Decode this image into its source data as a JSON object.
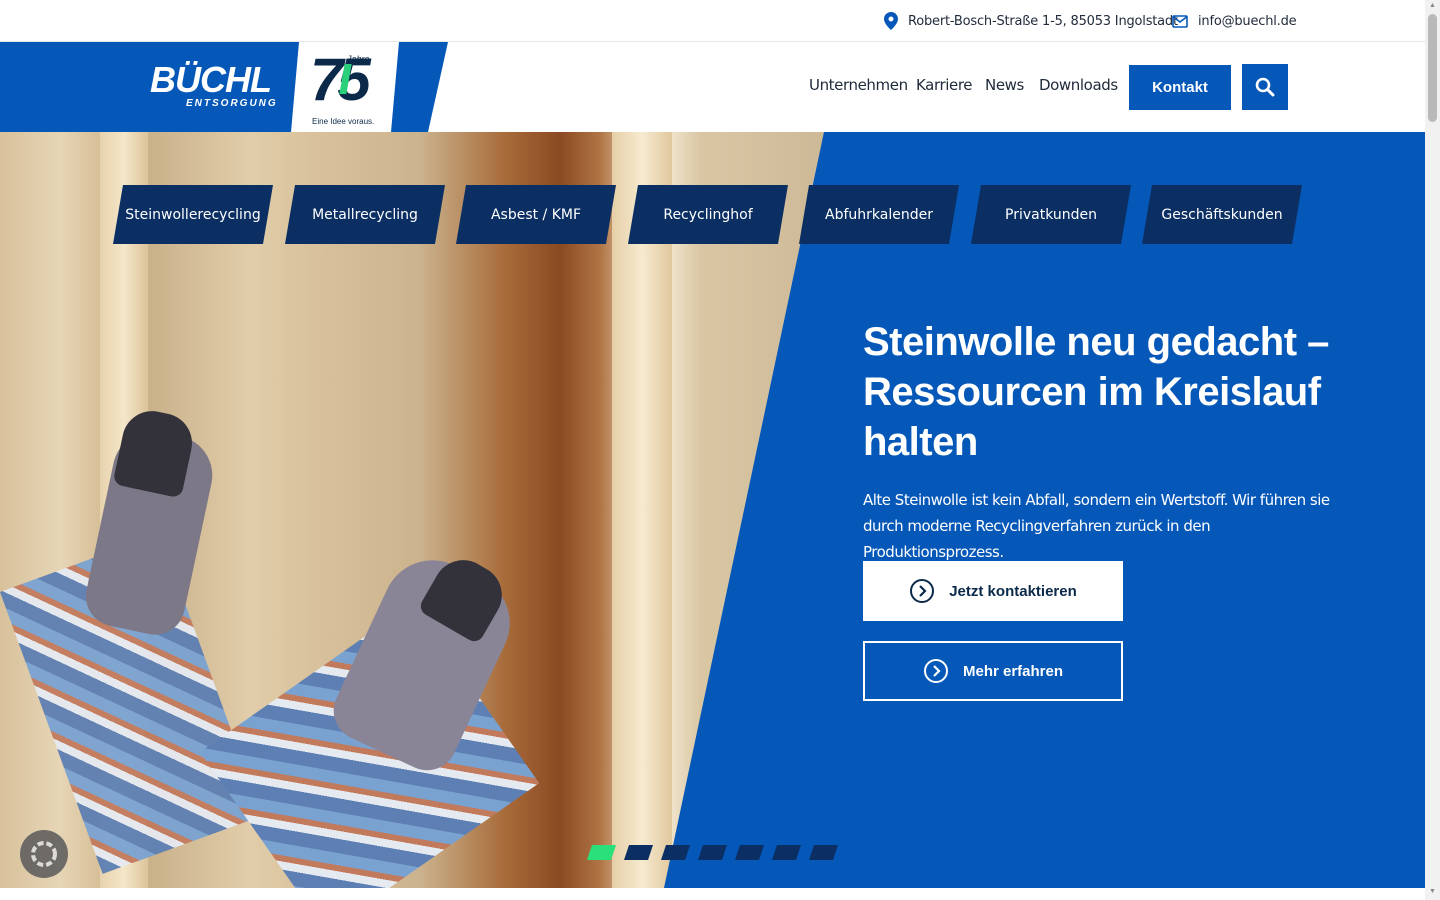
{
  "topbar": {
    "address": "Robert-Bosch-Straße 1-5, 85053 Ingolstadt",
    "email": "info@buechl.de"
  },
  "logo": {
    "brand": "BÜCHL",
    "sub": "ENTSORGUNG",
    "anniversary_number": "75",
    "anniversary_word": "Jahre",
    "slogan": "Eine Idee voraus."
  },
  "nav": {
    "items": [
      "Unternehmen",
      "Karriere",
      "News",
      "Downloads"
    ],
    "contact_label": "Kontakt"
  },
  "tabs": [
    "Steinwollerecycling",
    "Metallrecycling",
    "Asbest / KMF",
    "Recyclinghof",
    "Abfuhrkalender",
    "Privatkunden",
    "Geschäftskunden"
  ],
  "hero": {
    "headline": "Steinwolle neu gedacht – Ressourcen im Kreislauf halten",
    "description": "Alte Steinwolle ist kein Abfall, sondern ein Wertstoff. Wir führen sie durch moderne Recyclingverfahren zurück in den Produktionsprozess.",
    "cta_primary": "Jetzt kontaktieren",
    "cta_secondary": "Mehr erfahren"
  },
  "slider": {
    "count": 7,
    "active": 1
  },
  "colors": {
    "brand_blue": "#0557b8",
    "dark_navy": "#0b2f63",
    "accent_green": "#2ae07a"
  }
}
